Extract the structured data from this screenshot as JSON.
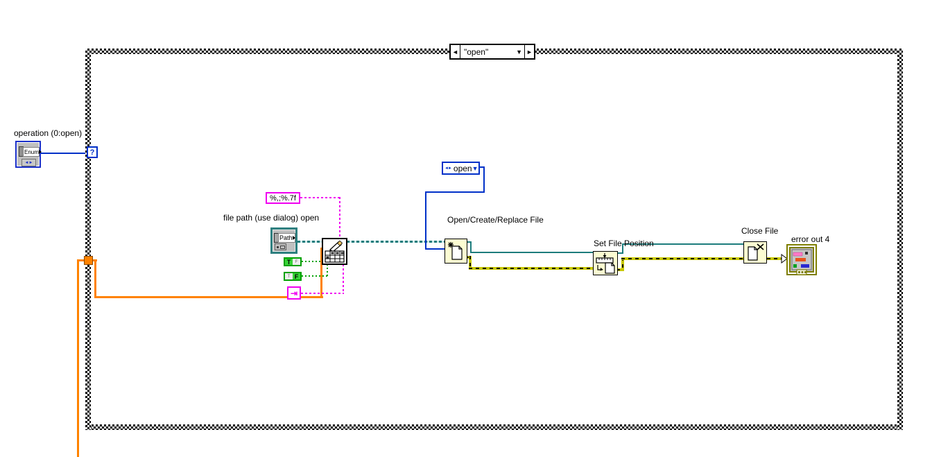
{
  "diagram": {
    "case_selector": {
      "value": "\"open\"",
      "left_arrow": "◄",
      "right_arrow": "►",
      "dropdown": "▼"
    },
    "selector_tunnel": "?",
    "operation_control": {
      "label": "operation (0:open)",
      "terminal_text": "Enum",
      "arrows": "◄►"
    },
    "format_constant": {
      "value": "%,;%.7f"
    },
    "file_path_control": {
      "label": "file path (use dialog) open",
      "terminal_text": "Path"
    },
    "bool_true": {
      "active": "T",
      "inactive": "F"
    },
    "bool_false": {
      "active": "F",
      "inactive": "T"
    },
    "tab_constant": {
      "glyph": "⇥"
    },
    "open_enum_constant": {
      "text": "open",
      "arrows": "◄►",
      "dropdown": "▼"
    },
    "open_file_node": {
      "label": "Open/Create/Replace File"
    },
    "set_position_node": {
      "label": "Set File Position"
    },
    "close_file_node": {
      "label": "Close File"
    },
    "error_out_indicator": {
      "label": "error out 4"
    },
    "colors": {
      "wire_error": "#C9C900",
      "wire_array_dbl": "#FF8200",
      "wire_enum": "#0030C8",
      "wire_path_refnum": "#1D7C7C",
      "wire_string": "#F000F0",
      "wire_boolean": "#00A000",
      "node_background": "#FCFCD2",
      "error_cluster_frame": "#7E7E00"
    }
  }
}
